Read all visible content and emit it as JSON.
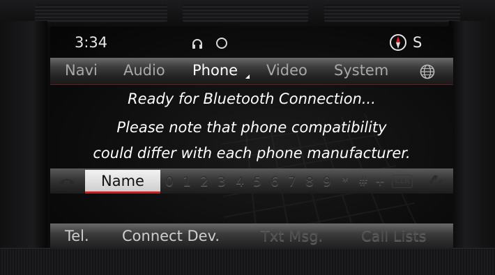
{
  "status": {
    "time": "3:34",
    "heading": "S",
    "icons": [
      "headphone-icon",
      "circle-icon",
      "compass-icon"
    ]
  },
  "menu": {
    "items": [
      {
        "label": "Navi"
      },
      {
        "label": "Audio"
      },
      {
        "label": "Phone"
      },
      {
        "label": "Video"
      },
      {
        "label": "System"
      }
    ],
    "active": "Phone",
    "globe_icon": "globe-icon"
  },
  "message": {
    "line1": "Ready for Bluetooth Connection...",
    "line2": "Please note that phone compatibility",
    "line3": "could differ with each phone manufacturer."
  },
  "input": {
    "name_label": "Name",
    "keys": [
      "0",
      "1",
      "2",
      "3",
      "4",
      "5",
      "6",
      "7",
      "8",
      "9",
      "*",
      "#",
      "+"
    ],
    "clear_label": "CLR",
    "icons": [
      "handset-icon",
      "call-icon"
    ]
  },
  "bottom": {
    "items": [
      {
        "label": "Tel.",
        "enabled": true
      },
      {
        "label": "Connect Dev.",
        "enabled": true
      },
      {
        "label": "Txt Msg.",
        "enabled": false
      },
      {
        "label": "Call Lists",
        "enabled": false
      }
    ]
  },
  "colors": {
    "accent_red": "#c62020",
    "text_white": "#ffffff",
    "inactive_gray": "#a9a9a9"
  }
}
